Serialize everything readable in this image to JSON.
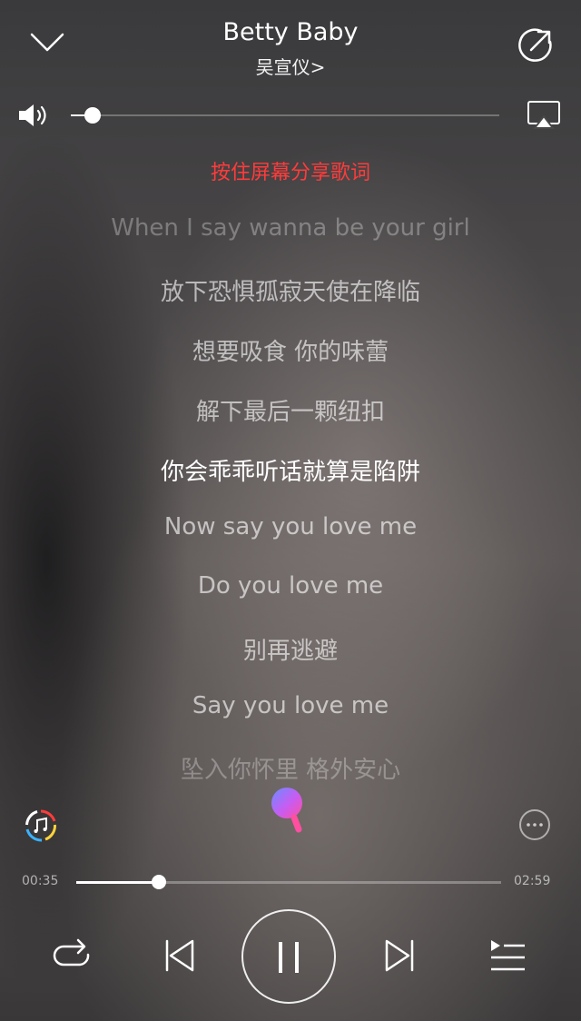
{
  "header": {
    "title": "Betty Baby",
    "artist": "吴宣仪>"
  },
  "volume": {
    "level": 0.05
  },
  "share_hint": "按住屏幕分享歌词",
  "lyrics": [
    {
      "text": "When I say wanna be your girl",
      "state": "faded"
    },
    {
      "text": "放下恐惧孤寂天使在降临",
      "state": "dim"
    },
    {
      "text": "想要吸食  你的味蕾",
      "state": "dim"
    },
    {
      "text": "解下最后一颗纽扣",
      "state": "dim"
    },
    {
      "text": "你会乖乖听话就算是陷阱",
      "state": "active"
    },
    {
      "text": "Now say you love me",
      "state": "dim"
    },
    {
      "text": "Do you love me",
      "state": "dim"
    },
    {
      "text": "别再逃避",
      "state": "dim"
    },
    {
      "text": "Say you love me",
      "state": "dim"
    },
    {
      "text": "坠入你怀里 格外安心",
      "state": "faded"
    }
  ],
  "playback": {
    "elapsed": "00:35",
    "duration": "02:59",
    "progress": 0.195
  },
  "colors": {
    "accent_red": "#ff3b3b",
    "mic_gradient": [
      "#6a8cff",
      "#c85cf2",
      "#ff4fa0"
    ]
  },
  "icons": {
    "collapse": "chevron-down-icon",
    "share": "share-icon",
    "volume": "speaker-icon",
    "airplay": "airplay-icon",
    "playlist": "music-ring-icon",
    "mic": "mic-icon",
    "more": "more-icon",
    "repeat": "repeat-icon",
    "prev": "previous-icon",
    "pause": "pause-icon",
    "next": "next-icon",
    "queue": "queue-icon"
  }
}
